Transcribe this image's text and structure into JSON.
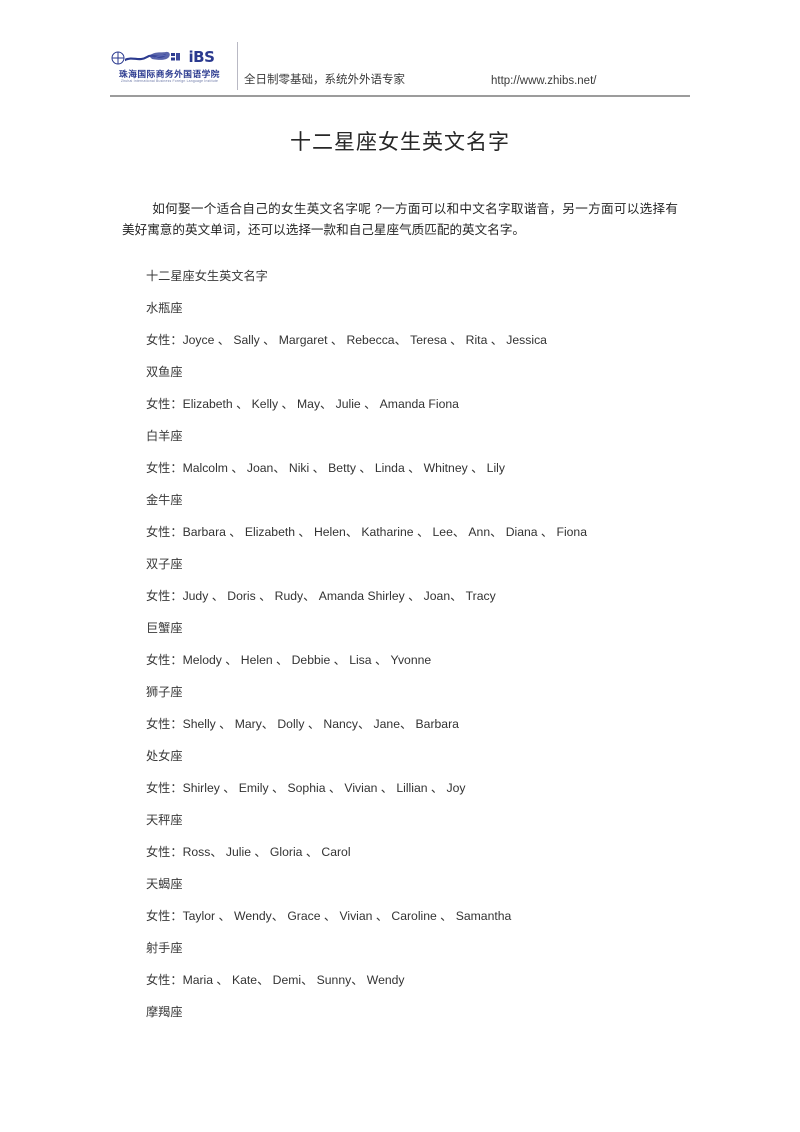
{
  "header": {
    "logo": {
      "brand": "iBS",
      "cn_name": "珠海国际商务外国语学院",
      "en_name": "Zhuhai International Business Foreign Language Institute",
      "mark_icon": "circled-cross-icon",
      "swoosh_icon": "swoosh-icon"
    },
    "slogan": "全日制零基础，系统外外语专家",
    "url": "http://www.zhibs.net/"
  },
  "title": "十二星座女生英文名字",
  "intro": {
    "text": "如何娶一个适合自己的女生英文名字呢    ?一方面可以和中文名字取谐音，另一方面可以选择有美好寓意的英文单词，还可以选择一款和自己星座气质匹配的英文名字。"
  },
  "content": {
    "heading": "十二星座女生英文名字",
    "female_label": "女性：",
    "sections": [
      {
        "sign": "水瓶座",
        "label": "女性：",
        "names": "Joyce 、 Sally  、 Margaret  、 Rebecca、 Teresa 、 Rita  、 Jessica"
      },
      {
        "sign": "双鱼座",
        "label": "女性：",
        "names": "Elizabeth   、 Kelly  、 May、 Julie  、 Amanda  Fiona"
      },
      {
        "sign": "白羊座",
        "label": "女性：",
        "names": "Malcolm  、 Joan、 Niki  、 Betty  、 Linda 、 Whitney 、 Lily"
      },
      {
        "sign": "金牛座",
        "label": "女性：",
        "names": "Barbara 、 Elizabeth   、 Helen、 Katharine  、 Lee、 Ann、 Diana 、 Fiona"
      },
      {
        "sign": "双子座",
        "label": "女性：",
        "names": "Judy 、 Doris  、 Rudy、 Amanda  Shirley  、 Joan、 Tracy"
      },
      {
        "sign": "巨蟹座",
        "label": "女性：",
        "names": "Melody 、 Helen  、 Debbie 、 Lisa  、 Yvonne"
      },
      {
        "sign": "狮子座",
        "label": "女性：",
        "names": "Shelly  、 Mary、 Dolly  、 Nancy、 Jane、 Barbara"
      },
      {
        "sign": "处女座",
        "label": "女性：",
        "names": "Shirley   、 Emily 、 Sophia 、 Vivian  、 Lillian    、 Joy"
      },
      {
        "sign": "天秤座",
        "label": "女性：",
        "names": "Ross、 Julie  、 Gloria  、 Carol"
      },
      {
        "sign": "天蝎座",
        "label": "女性：",
        "names": "Taylor  、 Wendy、 Grace 、 Vivian  、 Caroline  、 Samantha"
      },
      {
        "sign": "射手座",
        "label": "女性：",
        "names": "Maria 、 Kate、 Demi、 Sunny、 Wendy"
      },
      {
        "sign": "摩羯座",
        "label": "",
        "names": ""
      }
    ]
  }
}
